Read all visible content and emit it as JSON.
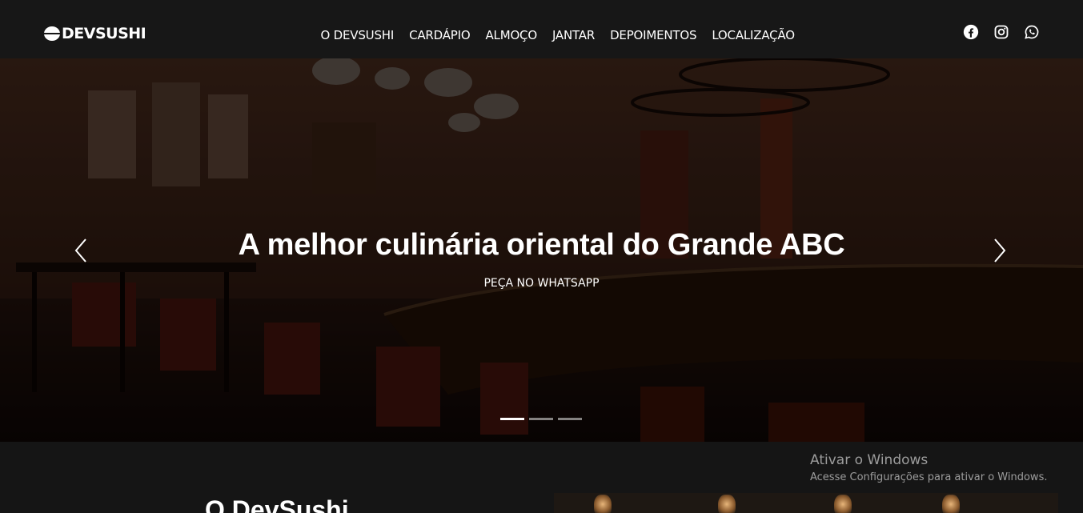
{
  "navbar": {
    "logo_text": "DEVSUSHI",
    "links": [
      "O DEVSUSHI",
      "CARDÁPIO",
      "ALMOÇO",
      "JANTAR",
      "DEPOIMENTOS",
      "LOCALIZAÇÃO"
    ],
    "social_icons": [
      "facebook-icon",
      "instagram-icon",
      "whatsapp-icon"
    ]
  },
  "hero": {
    "title": "A melhor culinária oriental do Grande ABC",
    "cta": "PEÇA NO WHATSAPP",
    "prev_icon": "chevron-left-icon",
    "next_icon": "chevron-right-icon",
    "slides_total": 3,
    "active_slide": 1
  },
  "about": {
    "title": "O DevSushi"
  },
  "watermark": {
    "title": "Ativar o Windows",
    "subtitle": "Acesse Configurações para ativar o Windows."
  },
  "colors": {
    "navbar_bg": "#171717",
    "page_bg": "#151515",
    "text": "#ffffff"
  }
}
